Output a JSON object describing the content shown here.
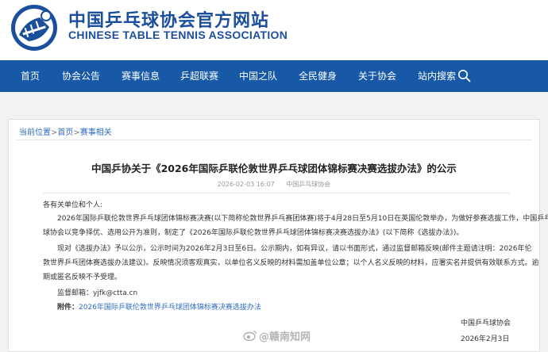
{
  "header": {
    "title_cn": "中国乒乓球协会官方网站",
    "title_en": "CHINESE TABLE TENNIS ASSOCIATION",
    "logo_icon": "ctta-logo-icon",
    "brand_color": "#1b4f9c"
  },
  "nav": {
    "items": [
      "首页",
      "协会公告",
      "赛事信息",
      "乒超联赛",
      "中国之队",
      "全民健身",
      "关于协会",
      "站内搜索"
    ],
    "search_icon": "search-icon",
    "bg_color": "#1759a6"
  },
  "breadcrumb": {
    "items": [
      "当前位置",
      "首页",
      "赛事相关"
    ],
    "separator": ">"
  },
  "article": {
    "title": "中国乒协关于《2026年国际乒联伦敦世界乒乓球团体锦标赛决赛选拔办法》的公示",
    "date": "2026-02-03 16:07",
    "source": "中国乒乓球协会",
    "greeting": "各有关单位和个人:",
    "para1_line1": "2026年国际乒联伦敦世界乒乓球团体锦标赛决赛(以下简称伦敦世界乒乓赛团体赛)将于4月28日至5月10日在英国伦敦举办，为做好参赛选拔工作，中国乒乓",
    "para1_line2": "球协会以竞争择优、选用公开为准则，制定了《2026年国际乒联伦敦世界乒乓球团体锦标赛决赛选拔办法》(以下简称《选拔办法》)。",
    "para2_line1": "现对《选拔办法》予以公示，公示时间为2026年2月3日至6日。公示期内，如有异议，请以书面形式，通过监督邮箱反映(邮件主题请注明：2026年伦",
    "para2_line2": "敦世界乒乓团体赛选拔办法建议)。反映情况须客观真实，以单位名义反映的材料需加盖单位公章；以个人名义反映的材料，应署实名并提供有效联系方式。逾",
    "para2_line3": "期或匿名反映不予受理。",
    "email_label": "监督邮箱：",
    "email": "yjfk@ctta.cn",
    "attachment_label": "附件：",
    "attachment_link": "2026年国际乒联伦敦世界乒乓球团体锦标赛决赛选拔办法",
    "signature_org": "中国乒乓球协会",
    "signature_date": "2026年2月3日"
  },
  "watermark": {
    "text": "@赣南知网",
    "icon": "weibo-icon"
  }
}
